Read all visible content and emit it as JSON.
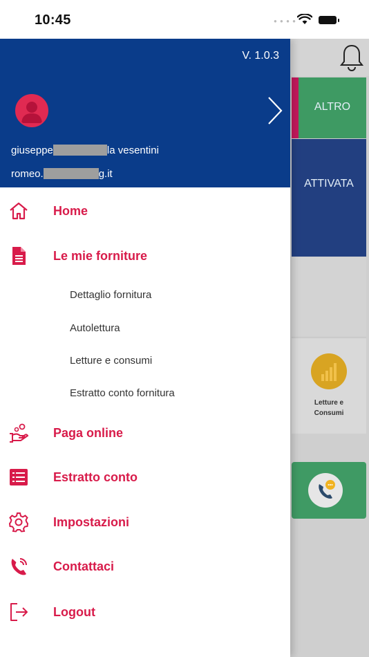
{
  "status_bar": {
    "time": "10:45"
  },
  "background": {
    "tiles": {
      "altro_label": "ALTRO",
      "attivata_label": "ATTIVATA",
      "letture_label_line1": "Letture e",
      "letture_label_line2": "Consumi"
    }
  },
  "drawer": {
    "version": "V. 1.0.3",
    "user": {
      "name_start": "giuseppe",
      "name_end": "la vesentini",
      "email_start": "romeo.",
      "email_end": "g.it"
    },
    "menu": [
      {
        "label": "Home",
        "icon": "home-icon"
      },
      {
        "label": "Le mie forniture",
        "icon": "document-icon"
      },
      {
        "label": "Paga online",
        "icon": "hand-coin-icon"
      },
      {
        "label": "Estratto conto",
        "icon": "list-icon"
      },
      {
        "label": "Impostazioni",
        "icon": "gear-icon"
      },
      {
        "label": "Contattaci",
        "icon": "phone-icon"
      },
      {
        "label": "Logout",
        "icon": "logout-icon"
      }
    ],
    "submenu": [
      {
        "label": "Dettaglio fornitura"
      },
      {
        "label": "Autolettura"
      },
      {
        "label": "Letture e consumi"
      },
      {
        "label": "Estratto conto fornitura"
      }
    ]
  },
  "colors": {
    "header_blue": "#0a3c8a",
    "accent_red": "#d81b4a",
    "tile_green": "#3e9a63",
    "tile_navy": "#223f80"
  }
}
